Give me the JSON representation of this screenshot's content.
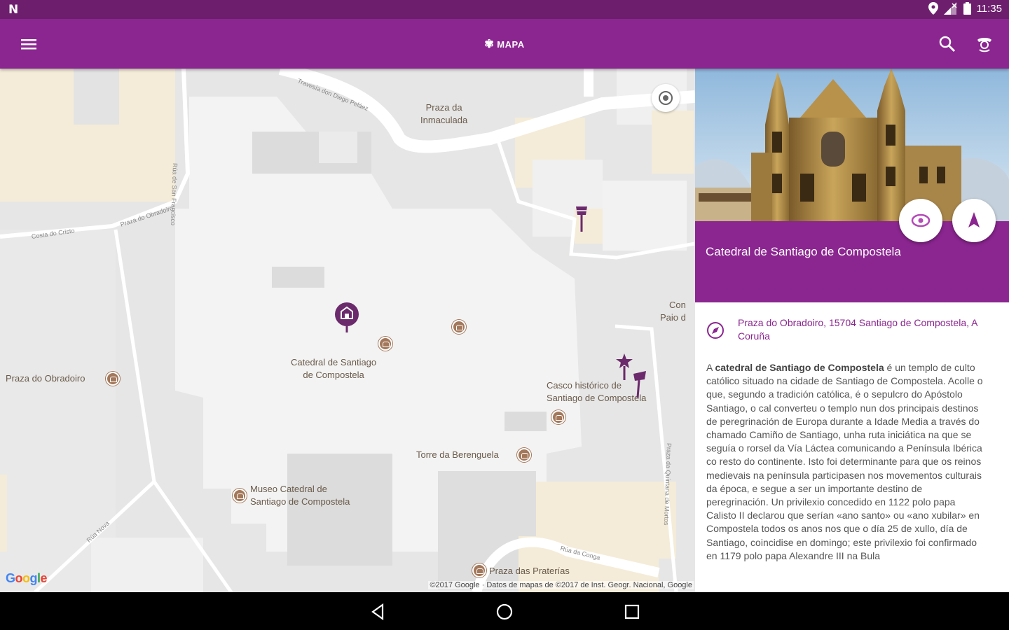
{
  "status_bar": {
    "time": "11:35"
  },
  "app_bar": {
    "title": "MAPA"
  },
  "map": {
    "labels": {
      "praza_inmaculada": "Praza da\nInmaculada",
      "catedral": "Catedral de Santiago\nde Compostela",
      "praza_obradoiro": "Praza do Obradoiro",
      "casco_historico": "Casco histórico de\nSantiago de Compostela",
      "torre_berenguela": "Torre da Berenguela",
      "museo_catedral": "Museo Catedral de\nSantiago de Compostela",
      "praza_praterias": "Praza das Praterías",
      "con_paio": "Con\nPaio d"
    },
    "streets": {
      "travesa": "Travesía don Diego Peláez",
      "san_francisco": "Rúa de San Francisco",
      "costa_cristo": "Costa do Cristo",
      "praza_obradoiro_street": "Praza do Obradoiro",
      "rua_nova": "Rúa Nova",
      "rua_conga": "Rúa da Conga",
      "quintana_mortos": "Praza da Quintana de Mortos"
    },
    "google_logo": "Google",
    "copyright": "©2017 Google · Datos de mapas de ©2017 de Inst. Geogr. Nacional, Google"
  },
  "panel": {
    "title": "Catedral de Santiago de Compostela",
    "address": "Praza do Obradoiro, 15704 Santiago de Compostela, A Coruña",
    "description_bold": "catedral de Santiago de Compostela",
    "description_prefix": "A ",
    "description": " é un templo de culto católico situado na cidade de Santiago de Compostela. Acolle o que, segundo a tradición católica, é o sepulcro do Apóstolo Santiago, o cal converteu o templo nun dos principais destinos de peregrinación de Europa durante a Idade Media a través do chamado Camiño de Santiago, unha ruta iniciática na que se seguía o rorsel da Vía Láctea comunicando a Península Ibérica co resto do continente. Isto foi determinante para que os reinos medievais na península participasen nos movementos culturais da época, e segue a ser un importante destino de peregrinación. Un privilexio concedido en 1122 polo papa Calisto II declarou que serían «ano santo» ou «ano xubilar» en Compostela todos os anos nos que o día 25 de xullo, día de Santiago, coincidise en domingo; este privilexio foi confirmado en 1179 polo papa Alexandre III na Bula"
  },
  "colors": {
    "primary": "#8b2590",
    "primary_dark": "#6d1f6e",
    "poi": "#a3775a",
    "marker": "#6b2a6b"
  }
}
